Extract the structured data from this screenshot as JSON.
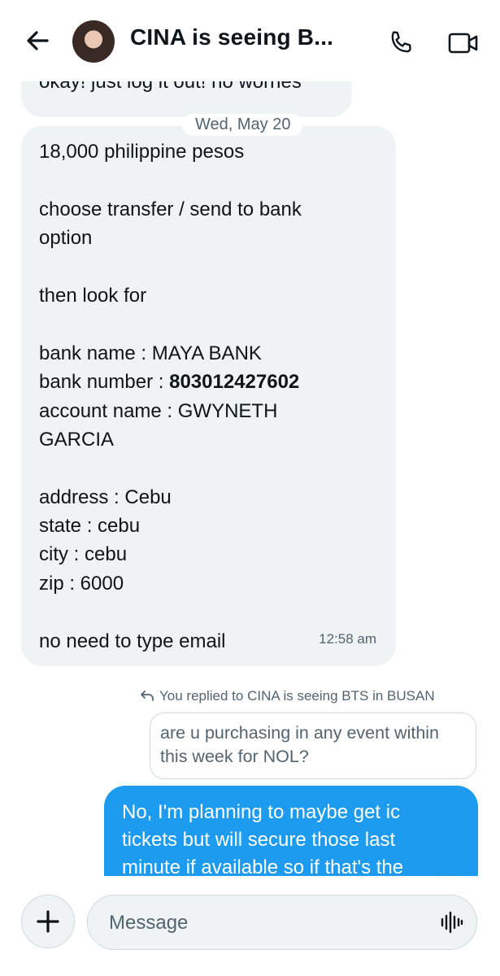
{
  "header": {
    "title": "CINA is seeing B...",
    "avatar_label": "avatar"
  },
  "messages": {
    "first": "okay! just log it out! no worries",
    "date_separator": "Wed, May 20",
    "details": {
      "lines": [
        "18,000 philippine pesos",
        "",
        "choose transfer / send to bank",
        "option",
        "",
        "then look for",
        "",
        "bank name : MAYA BANK",
        "bank number : ",
        "account name : GWYNETH",
        "GARCIA",
        "",
        "address : Cebu",
        "state : cebu",
        "city : cebu",
        "zip : 6000",
        "",
        "no need to type email"
      ],
      "bank_number_value": "803012427602",
      "time": "12:58 am"
    },
    "reply_context": "You replied to CINA is seeing BTS in BUSAN",
    "quoted_text": "are u purchasing in any event within this week for NOL?",
    "outgoing": "No, I'm planning to maybe get ic tickets but will secure those last minute if available so if that's the"
  },
  "composer": {
    "placeholder": "Message"
  },
  "colors": {
    "accent": "#1d9bf0",
    "incoming_bubble": "#eff3f4",
    "secondary_text": "#536471"
  },
  "icons": [
    "back-arrow-icon",
    "phone-icon",
    "video-icon",
    "reply-arrow-icon",
    "arrow-down-icon",
    "plus-icon",
    "voice-waveform-icon"
  ]
}
